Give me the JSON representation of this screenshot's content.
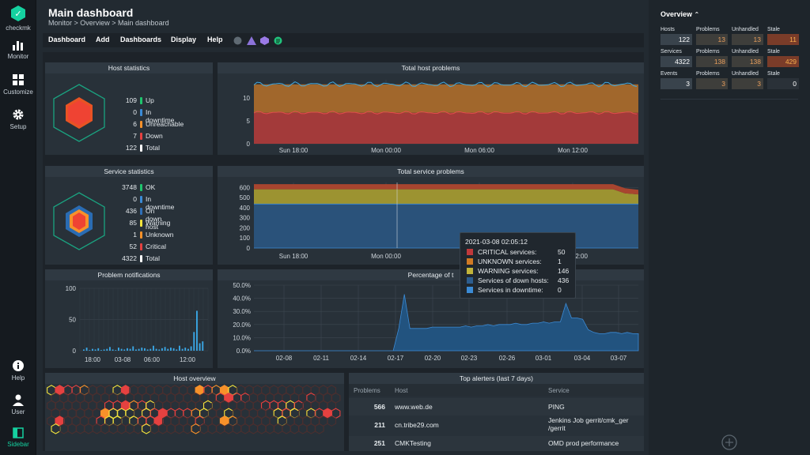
{
  "brand": {
    "name": "checkmk"
  },
  "sidebar_nav": {
    "monitor": "Monitor",
    "customize": "Customize",
    "setup": "Setup",
    "help": "Help",
    "user": "User",
    "sidebar": "Sidebar"
  },
  "header": {
    "title": "Main dashboard",
    "breadcrumb": "Monitor > Overview > Main dashboard"
  },
  "menu": [
    "Dashboard",
    "Add",
    "Dashboards",
    "Display",
    "Help"
  ],
  "host_statistics": {
    "title": "Host statistics",
    "rows": [
      {
        "count": "109",
        "label": "Up",
        "color": "#1fc46d"
      },
      {
        "count": "0",
        "label": "In downtime",
        "color": "#3b8bd6"
      },
      {
        "count": "6",
        "label": "Unreachable",
        "color": "#f7912a"
      },
      {
        "count": "7",
        "label": "Down",
        "color": "#e54140"
      },
      {
        "count": "122",
        "label": "Total",
        "color": "#ffffff"
      }
    ]
  },
  "service_statistics": {
    "title": "Service statistics",
    "rows": [
      {
        "count": "3748",
        "label": "OK",
        "color": "#1fc46d"
      },
      {
        "count": "0",
        "label": "In downtime",
        "color": "#3b8bd6"
      },
      {
        "count": "436",
        "label": "On down host",
        "color": "#2f6fb8"
      },
      {
        "count": "85",
        "label": "Warning",
        "color": "#f2e33c"
      },
      {
        "count": "1",
        "label": "Unknown",
        "color": "#f7912a"
      },
      {
        "count": "52",
        "label": "Critical",
        "color": "#e54140"
      },
      {
        "count": "4322",
        "label": "Total",
        "color": "#ffffff"
      }
    ]
  },
  "total_host_problems": {
    "title": "Total host problems",
    "x_ticks": [
      "Sun 18:00",
      "Mon 00:00",
      "Mon 06:00",
      "Mon 12:00"
    ],
    "y_ticks": [
      "0",
      "5",
      "10"
    ]
  },
  "total_service_problems": {
    "title": "Total service problems",
    "x_ticks": [
      "Sun 18:00",
      "Mon 00:00",
      "Mon 06:00",
      "Mon 12:00"
    ],
    "y_ticks": [
      "0",
      "100",
      "200",
      "300",
      "400",
      "500",
      "600"
    ]
  },
  "tooltip": {
    "time": "2021-03-08 02:05:12",
    "rows": [
      {
        "label": "CRITICAL services:",
        "value": "50",
        "color": "#c0393b"
      },
      {
        "label": "UNKNOWN services:",
        "value": "1",
        "color": "#d07a24"
      },
      {
        "label": "WARNING services:",
        "value": "146",
        "color": "#c2b43a"
      },
      {
        "label": "Services of down hosts:",
        "value": "436",
        "color": "#2c5d8f"
      },
      {
        "label": "Services in downtime:",
        "value": "0",
        "color": "#3b8bd6"
      }
    ]
  },
  "problem_notifications": {
    "title": "Problem notifications",
    "x_ticks": [
      "18:00",
      "03-08",
      "06:00",
      "12:00"
    ],
    "y_ticks": [
      "0",
      "50",
      "100"
    ]
  },
  "percentage_panel": {
    "title": "Percentage of t",
    "x_ticks": [
      "02-08",
      "02-11",
      "02-14",
      "02-17",
      "02-20",
      "02-23",
      "02-26",
      "03-01",
      "03-04",
      "03-07"
    ],
    "y_ticks": [
      "0.0%",
      "10.0%",
      "20.0%",
      "30.0%",
      "40.0%",
      "50.0%"
    ]
  },
  "host_overview": {
    "title": "Host overview"
  },
  "top_alerters": {
    "title": "Top alerters (last 7 days)",
    "headers": [
      "Problems",
      "Host",
      "Service"
    ],
    "rows": [
      {
        "problems": "566",
        "host": "www.web.de",
        "service": "PING"
      },
      {
        "problems": "211",
        "host": "cn.tribe29.com",
        "service": "Jenkins Job gerrit/cmk_ger\n/gerrit"
      },
      {
        "problems": "251",
        "host": "CMKTesting",
        "service": "OMD prod performance"
      }
    ]
  },
  "overview": {
    "title": "Overview",
    "columns": [
      "Hosts",
      "Problems",
      "Unhandled",
      "Stale"
    ],
    "rows": [
      {
        "labels": [
          "Hosts",
          "Problems",
          "Unhandled",
          "Stale"
        ],
        "values": [
          "122",
          "13",
          "13",
          "11"
        ]
      },
      {
        "labels": [
          "Services",
          "Problems",
          "Unhandled",
          "Stale"
        ],
        "values": [
          "4322",
          "138",
          "138",
          "429"
        ]
      },
      {
        "labels": [
          "Events",
          "Problems",
          "Unhandled",
          "Stale"
        ],
        "values": [
          "3",
          "3",
          "3",
          "0"
        ]
      }
    ]
  },
  "chart_data": [
    {
      "type": "area",
      "title": "Total host problems",
      "y_range": [
        0,
        14
      ],
      "x": [
        "Sun 18:00",
        "Mon 00:00",
        "Mon 06:00",
        "Mon 12:00"
      ],
      "series": [
        {
          "name": "Down",
          "approx_level": 7
        },
        {
          "name": "Unreachable",
          "approx_level": 13
        }
      ]
    },
    {
      "type": "area",
      "title": "Total service problems",
      "y_range": [
        0,
        650
      ],
      "series": [
        {
          "name": "Services of down hosts",
          "level": 436
        },
        {
          "name": "WARNING services",
          "level": 146
        },
        {
          "name": "UNKNOWN services",
          "level": 1
        },
        {
          "name": "CRITICAL services",
          "level": 50
        }
      ]
    },
    {
      "type": "bar",
      "title": "Problem notifications",
      "ylim": [
        0,
        100
      ],
      "values": [
        2,
        5,
        1,
        3,
        2,
        4,
        1,
        2,
        3,
        6,
        2,
        1,
        5,
        3,
        2,
        4,
        3,
        7,
        2,
        3,
        5,
        4,
        2,
        3,
        8,
        3,
        2,
        4,
        6,
        3,
        5,
        4,
        2,
        8,
        3,
        5,
        3,
        7,
        30,
        64,
        12,
        15
      ]
    },
    {
      "type": "area",
      "title": "Percentage of t",
      "ylim": [
        0,
        50
      ],
      "x": [
        "02-08",
        "02-11",
        "02-14",
        "02-17",
        "02-20",
        "02-23",
        "02-26",
        "03-01",
        "03-04",
        "03-07"
      ],
      "series": [
        {
          "name": "",
          "values": [
            0,
            0,
            0,
            0,
            0,
            0,
            0,
            0,
            0,
            0,
            0,
            0,
            0,
            0,
            0,
            0,
            0,
            0,
            0,
            0,
            0,
            0,
            0,
            0,
            0,
            0,
            17,
            43,
            17,
            17,
            17,
            17,
            18,
            18,
            18,
            18,
            18,
            18,
            19,
            18,
            19,
            19,
            20,
            19,
            20,
            20,
            20,
            21,
            20,
            20,
            21,
            21,
            22,
            21,
            22,
            22,
            36,
            25,
            25,
            24,
            16,
            14,
            13,
            13,
            14,
            14,
            13,
            14,
            13,
            13
          ]
        }
      ]
    }
  ]
}
